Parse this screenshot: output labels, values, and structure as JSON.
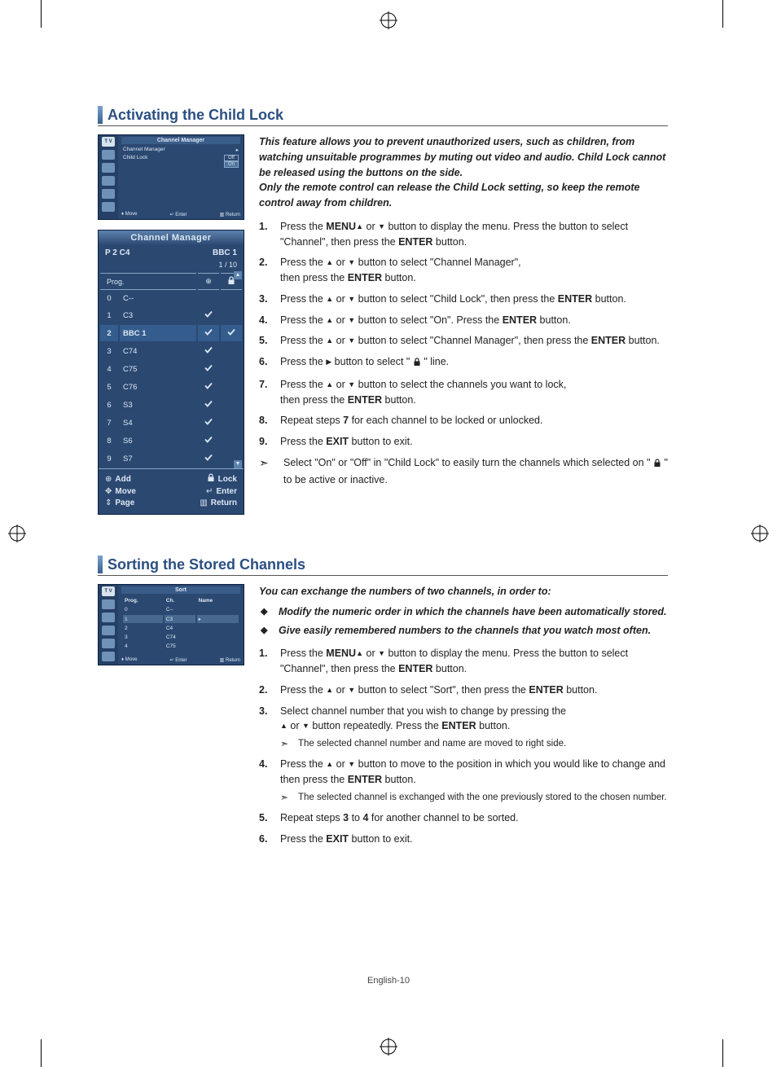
{
  "page_footer": "English-10",
  "s1": {
    "title": "Activating the Child Lock",
    "intro": "This feature allows you to prevent unauthorized users, such as children, from watching unsuitable programmes by muting out video and audio. Child Lock cannot be released using the buttons on the side.\nOnly the remote control can release the Child Lock setting, so keep the remote control away from children.",
    "steps": [
      {
        "n": "1.",
        "pre": "Press the ",
        "b1": "MENU",
        "mid": " button to display the menu.  Press the ",
        "arrows": "updown",
        "post": " button to select \"Channel\", then press the ",
        "b2": "ENTER",
        "tail": " button."
      },
      {
        "n": "2.",
        "pre": "Press the ",
        "arrows": "updown",
        "mid": " button to select \"Channel Manager\",",
        "br": true,
        "post": "then press the ",
        "b2": "ENTER",
        "tail": " button."
      },
      {
        "n": "3.",
        "pre": "Press the ",
        "arrows": "updown",
        "mid": " button to select \"Child Lock\",  then press the ",
        "b2": "ENTER",
        "tail": " button."
      },
      {
        "n": "4.",
        "pre": "Press the ",
        "arrows": "updown",
        "mid": " button to select \"On\". Press the ",
        "b2": "ENTER",
        "tail": " button."
      },
      {
        "n": "5.",
        "pre": "Press the ",
        "arrows": "updown",
        "mid": " button to select \"Channel Manager\",  then press the ",
        "b2": "ENTER",
        "tail": " button."
      },
      {
        "n": "6.",
        "pre": "Press the ",
        "arrow": "right",
        "mid": " button to select \" ",
        "lock": true,
        "tail": " \" line."
      },
      {
        "n": "7.",
        "pre": "Press the ",
        "arrows": "updown",
        "mid": " button to select the channels you want to lock,",
        "br": true,
        "post": "then press the ",
        "b2": "ENTER",
        "tail": " button."
      },
      {
        "n": "8.",
        "plain_pre": "Repeat steps ",
        "b1": "7",
        "plain_post": " for each channel to be locked or unlocked."
      },
      {
        "n": "9.",
        "plain_pre": "Press the ",
        "b1": "EXIT",
        "plain_post": " button to exit."
      }
    ],
    "note_pre": "Select \"On\" or \"Off\" in \"Child Lock\" to easily turn the channels which selected on \" ",
    "note_post": " \" to be active or inactive.",
    "osd1": {
      "tv_label": "T V",
      "header": "Channel Manager",
      "row1": "Channel Manager",
      "row2_label": "Child Lock",
      "opt_off": "Off",
      "opt_on": "On",
      "f_move": "Move",
      "f_enter": "Enter",
      "f_return": "Return"
    },
    "cm": {
      "header": "Channel Manager",
      "sub_left": "P  2   C4",
      "sub_right": "BBC 1",
      "count": "1 / 10",
      "cols": {
        "prog": "Prog."
      },
      "rows": [
        {
          "n": "0",
          "ch": "C--",
          "add": false,
          "lock": false,
          "hl": false
        },
        {
          "n": "1",
          "ch": "C3",
          "add": true,
          "lock": false,
          "hl": false
        },
        {
          "n": "2",
          "ch": "BBC 1",
          "add": true,
          "lock": true,
          "hl": true
        },
        {
          "n": "3",
          "ch": "C74",
          "add": true,
          "lock": false,
          "hl": false
        },
        {
          "n": "4",
          "ch": "C75",
          "add": true,
          "lock": false,
          "hl": false
        },
        {
          "n": "5",
          "ch": "C76",
          "add": true,
          "lock": false,
          "hl": false
        },
        {
          "n": "6",
          "ch": "S3",
          "add": true,
          "lock": false,
          "hl": false
        },
        {
          "n": "7",
          "ch": "S4",
          "add": true,
          "lock": false,
          "hl": false
        },
        {
          "n": "8",
          "ch": "S6",
          "add": true,
          "lock": false,
          "hl": false
        },
        {
          "n": "9",
          "ch": "S7",
          "add": true,
          "lock": false,
          "hl": false
        }
      ],
      "foot": {
        "add": "Add",
        "lock": "Lock",
        "move": "Move",
        "enter": "Enter",
        "page": "Page",
        "return": "Return"
      }
    }
  },
  "s2": {
    "title": "Sorting the Stored Channels",
    "intro": "You can exchange the numbers of two channels, in order to:",
    "bullets": [
      "Modify the numeric order in which the channels have been automatically stored.",
      "Give easily remembered numbers to the channels that you watch most often."
    ],
    "steps": [
      {
        "n": "1.",
        "pre": "Press the ",
        "b1": "MENU",
        "mid": " button to display the menu.  Press the ",
        "arrows": "updown",
        "post": " button to select \"Channel\", then press the ",
        "b2": "ENTER",
        "tail": " button."
      },
      {
        "n": "2.",
        "pre": "Press the ",
        "arrows": "updown",
        "mid": " button to select \"Sort\", then press the ",
        "b2": "ENTER",
        "tail": " button."
      },
      {
        "n": "3.",
        "plain": "Select channel number that you wish to change by pressing the",
        "line2_arrows": true,
        "line2_mid": " button repeatedly. Press the ",
        "line2_b": "ENTER",
        "line2_tail": " button.",
        "sub": "The selected channel number and name are moved to right side."
      },
      {
        "n": "4.",
        "pre": "Press the ",
        "arrows": "updown",
        "mid": " button to move to the position in which you would like to change  and then press the  ",
        "b2": "ENTER",
        "tail": " button.",
        "sub": "The selected channel is exchanged with the one previously stored to the chosen number."
      },
      {
        "n": "5.",
        "plain_pre": "Repeat steps ",
        "b1": "3",
        "mid_plain": " to ",
        "b2": "4",
        "plain_post": " for another channel to be sorted."
      },
      {
        "n": "6.",
        "plain_pre": "Press the ",
        "b1": "EXIT",
        "plain_post": " button to exit."
      }
    ],
    "osd": {
      "tv_label": "T V",
      "header": "Sort",
      "cols": {
        "prog": "Prog.",
        "ch": "Ch.",
        "name": "Name"
      },
      "rows": [
        {
          "p": "0",
          "c": "C--",
          "sel": false
        },
        {
          "p": "1",
          "c": "C3",
          "sel": true
        },
        {
          "p": "2",
          "c": "C4",
          "sel": false
        },
        {
          "p": "3",
          "c": "C74",
          "sel": false
        },
        {
          "p": "4",
          "c": "C75",
          "sel": false
        }
      ],
      "f_move": "Move",
      "f_enter": "Enter",
      "f_return": "Return"
    }
  }
}
